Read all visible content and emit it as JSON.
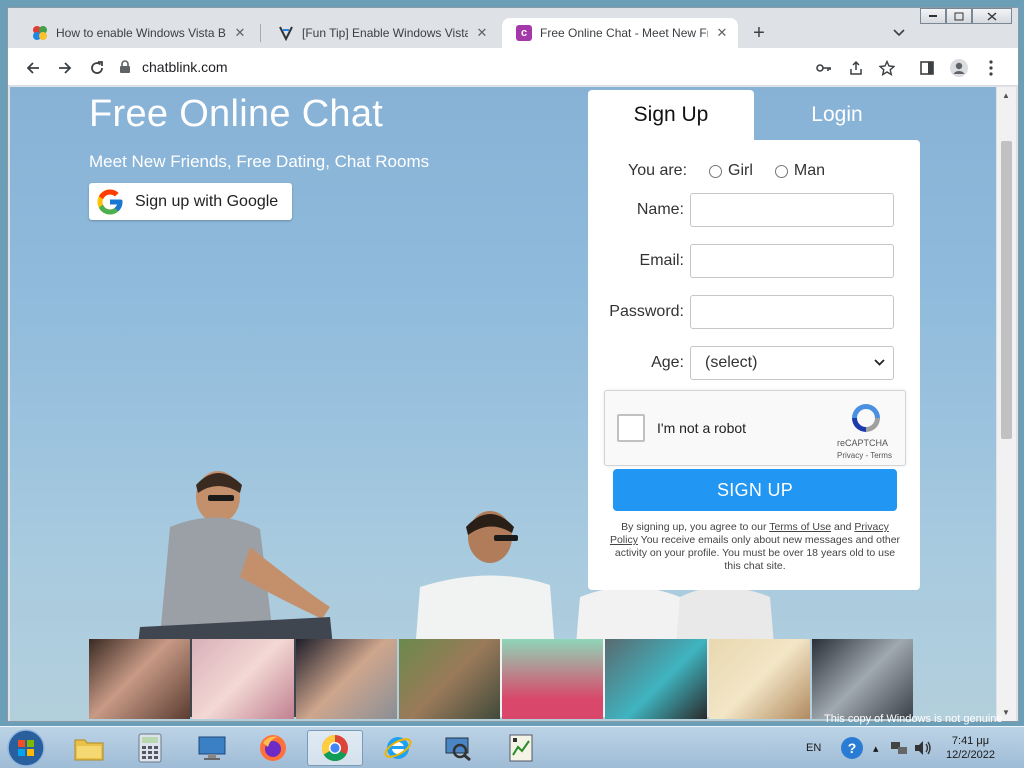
{
  "browser": {
    "tabs": [
      {
        "title": "How to enable Windows Vista Bo",
        "favicon": "colorful-puzzle-icon",
        "active": false
      },
      {
        "title": "[Fun Tip] Enable Windows Vista B",
        "favicon": "vista-tip-icon",
        "active": false
      },
      {
        "title": "Free Online Chat - Meet New Frie",
        "favicon": "c",
        "active": true
      }
    ],
    "new_tab": "+",
    "url": "chatblink.com"
  },
  "hero": {
    "title": "Free Online Chat",
    "subtitle": "Meet New Friends, Free Dating, Chat Rooms",
    "google_button": "Sign up with Google"
  },
  "signup": {
    "tab_signup": "Sign Up",
    "tab_login": "Login",
    "you_are_label": "You are:",
    "gender_options": [
      "Girl",
      "Man"
    ],
    "name_label": "Name:",
    "email_label": "Email:",
    "password_label": "Password:",
    "age_label": "Age:",
    "age_value": "(select)",
    "captcha_text": "I'm not a robot",
    "captcha_brand": "reCAPTCHA",
    "captcha_links": "Privacy - Terms",
    "button": "SIGN UP",
    "legal_pre": "By signing up, you agree to our ",
    "legal_terms": "Terms of Use",
    "legal_and": " and ",
    "legal_privacy": "Privacy Policy",
    "legal_post": " You receive emails only about new messages and other activity on your profile. You must be over 18 years old to use this chat site."
  },
  "taskbar": {
    "lang": "EN",
    "time": "7:41 μμ",
    "date": "12/2/2022",
    "watermark": "This copy of Windows is not genuine"
  },
  "colors": {
    "accent": "#2196f3",
    "hero_text": "#ffffff"
  }
}
